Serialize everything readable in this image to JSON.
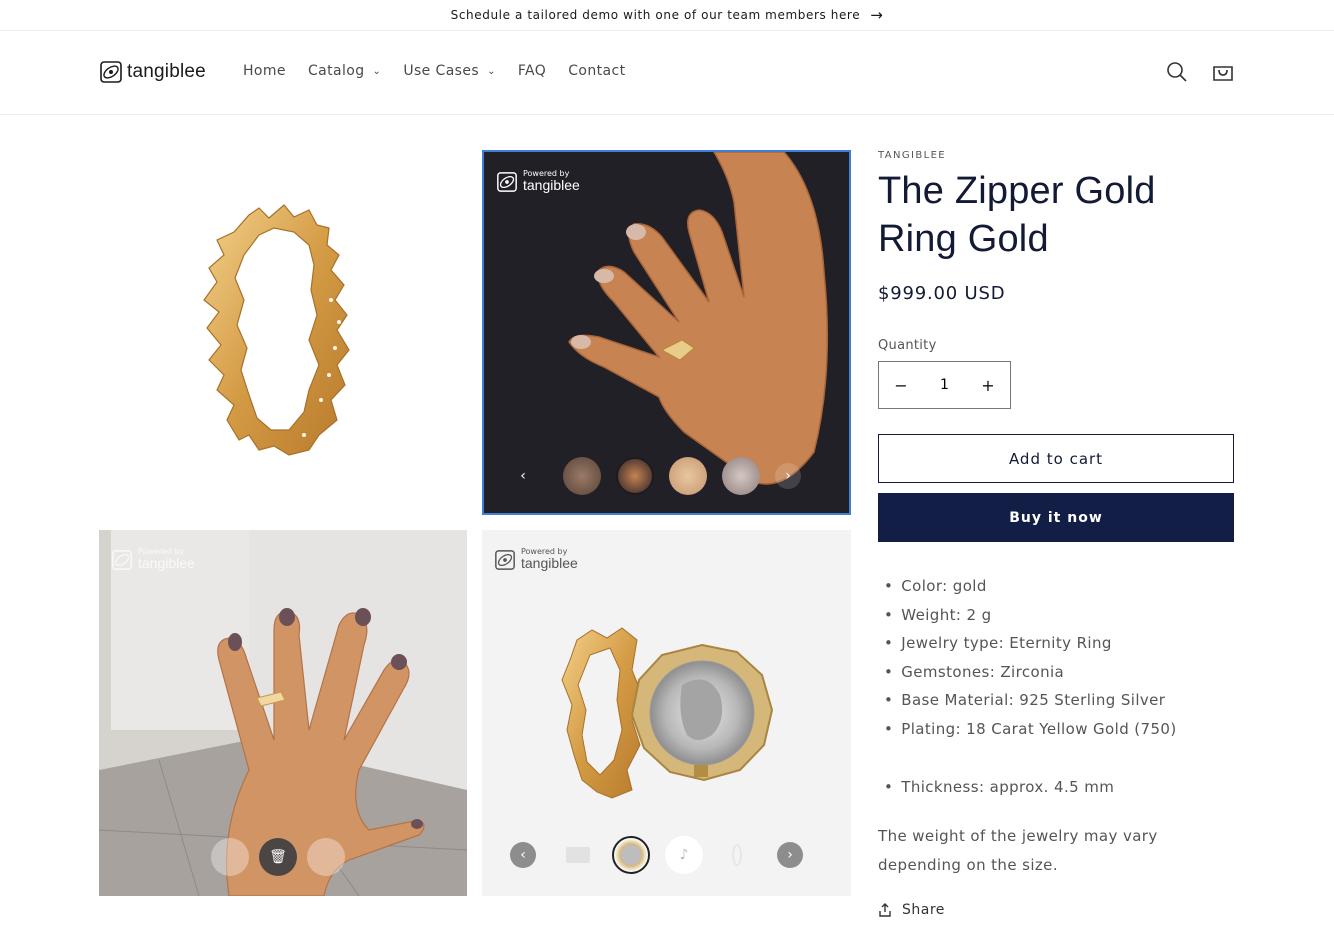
{
  "announcement": {
    "text": "Schedule a tailored demo with one of our team members here"
  },
  "brand": {
    "name": "tangiblee"
  },
  "nav": {
    "items": [
      {
        "label": "Home",
        "dropdown": false
      },
      {
        "label": "Catalog",
        "dropdown": true
      },
      {
        "label": "Use Cases",
        "dropdown": true
      },
      {
        "label": "FAQ",
        "dropdown": false
      },
      {
        "label": "Contact",
        "dropdown": false
      }
    ]
  },
  "widget": {
    "powered_by": "Powered by",
    "brand": "tangiblee"
  },
  "product": {
    "vendor": "TANGIBLEE",
    "title": "The Zipper Gold Ring Gold",
    "price": "$999.00 USD",
    "quantity_label": "Quantity",
    "quantity": "1",
    "add_to_cart": "Add to cart",
    "buy_now": "Buy it now",
    "specs": [
      "Color: gold",
      "Weight: 2 g",
      "Jewelry type: Eternity Ring",
      "Gemstones: Zirconia",
      "Base Material: 925 Sterling Silver",
      "Plating: 18 Carat Yellow Gold (750)"
    ],
    "thickness": "Thickness: approx. 4.5 mm",
    "note": "The weight of the jewelry may vary depending on the size.",
    "share": "Share"
  },
  "colors": {
    "navy": "#121e45",
    "accent_border": "#3f7fd9",
    "gold": "#d9a84e"
  }
}
